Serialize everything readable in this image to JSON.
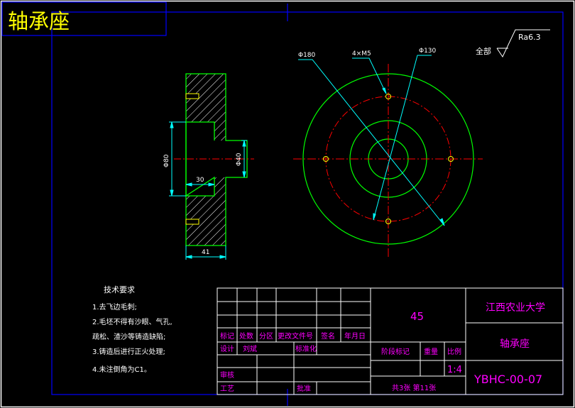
{
  "title": "轴承座",
  "surface_finish": {
    "prefix": "全部",
    "value": "Ra6.3"
  },
  "side_view": {
    "dims": {
      "bore_dia": "Φ80",
      "hub_dia": "Φ40",
      "depth": "30",
      "thickness": "41"
    }
  },
  "front_view": {
    "labels": {
      "outer": "Φ180",
      "bolts": "4×M5",
      "pitch": "Φ130"
    }
  },
  "tech_req": {
    "heading": "技术要求",
    "lines": [
      "1.去飞边毛刺;",
      "2.毛坯不得有沙眼、气孔,",
      "疏松、渣沙等铸造缺陷;",
      "3.铸造后进行正火处理;",
      "4.未注倒角为C1。"
    ]
  },
  "title_block": {
    "material": "45",
    "school": "江西农业大学",
    "part_name": "轴承座",
    "drawing_no": "YBHC-00-07",
    "scale_header": "比例",
    "weight_header": "重量",
    "stage_header": "阶段标记",
    "scale": "1:4",
    "sheets": "共3张 第11张",
    "row_headers": [
      "标记",
      "处数",
      "分区",
      "更改文件号",
      "签名",
      "年月日"
    ],
    "designer_label": "设计",
    "designer": "刘斌",
    "standardize": "标准化",
    "review": "审核",
    "process": "工艺",
    "approve": "批准"
  },
  "colors": {
    "frame": "#0000ff",
    "border": "#ffffff",
    "title_text": "#ffff00",
    "part_outline": "#00ff00",
    "dimension": "#00ffff",
    "centerline": "#ff0000",
    "table_text": "#ff00ff"
  }
}
